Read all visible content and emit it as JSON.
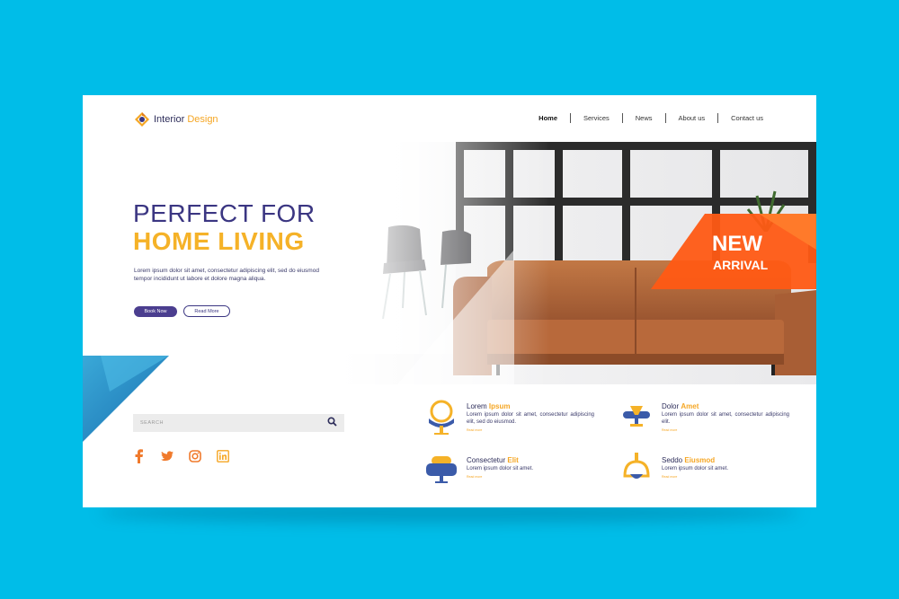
{
  "header": {
    "logo_primary": "Interior",
    "logo_accent": "Design",
    "nav": [
      "Home",
      "Services",
      "News",
      "About us",
      "Contact us"
    ]
  },
  "hero": {
    "title_line1": "PERFECT FOR",
    "title_line2": "HOME LIVING",
    "description": "Lorem ipsum dolor sit amet, consectetur adipiscing elit, sed do eiusmod tempor incididunt ut labore et dolore magna aliqua.",
    "book_button": "Book Now",
    "read_button": "Read More",
    "badge_line1": "NEW",
    "badge_line2": "ARRIVAL"
  },
  "search": {
    "placeholder": "SEARCH"
  },
  "socials": [
    "facebook-icon",
    "twitter-icon",
    "instagram-icon",
    "linkedin-icon"
  ],
  "features": [
    {
      "title": "Lorem",
      "title_accent": "Ipsum",
      "text": "Lorem ipsum dolor sit amet, consectetur adipiscing elit, sed do eiusmod.",
      "more": "Read more"
    },
    {
      "title": "Dolor",
      "title_accent": "Amet",
      "text": "Lorem ipsum dolor sit amet, consectetur adipiscing elit.",
      "more": "Read more"
    },
    {
      "title": "Consectetur",
      "title_accent": "Elit",
      "text": "Lorem ipsum dolor sit amet.",
      "more": "Read more"
    },
    {
      "title": "Seddo",
      "title_accent": "Eiusmod",
      "text": "Lorem ipsum dolor sit amet.",
      "more": "Read more"
    }
  ],
  "colors": {
    "background": "#00bde8",
    "brand_purple": "#3b3682",
    "brand_yellow": "#f5b228",
    "badge_orange": "#ff5a14",
    "sofa_brown": "#b86a3e"
  }
}
